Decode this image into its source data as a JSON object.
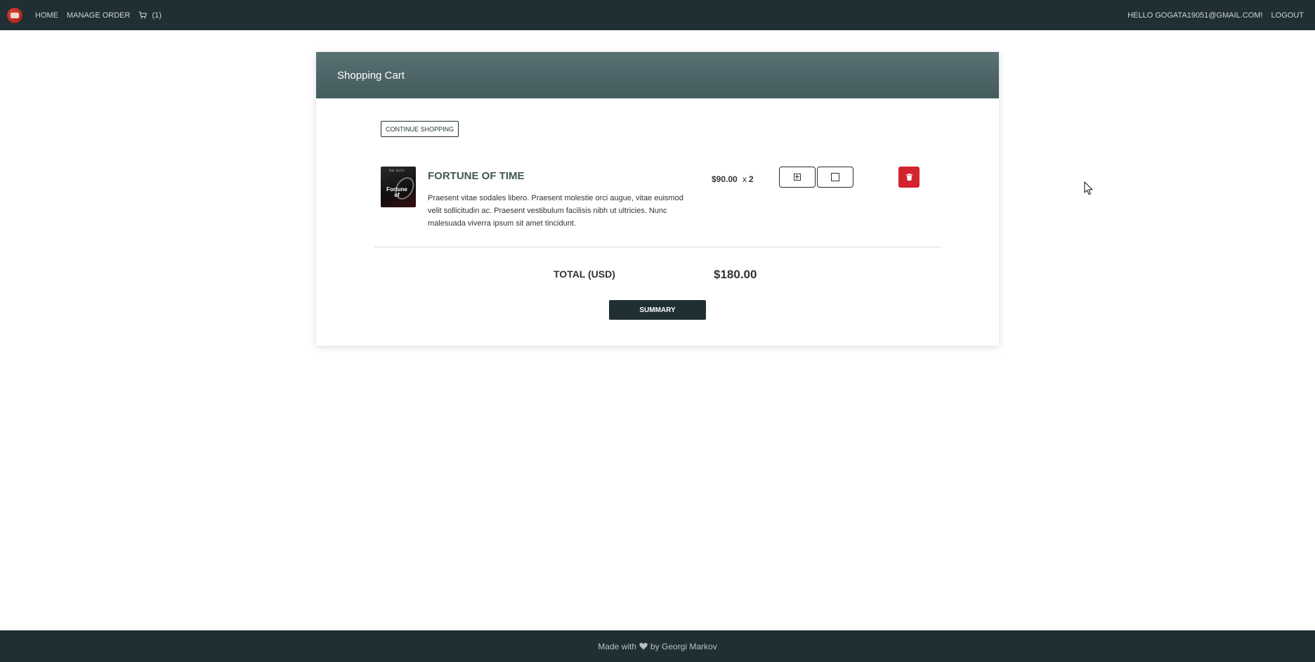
{
  "nav": {
    "home": "HOME",
    "manage_order": "MANAGE ORDER",
    "cart_count": "(1)",
    "greeting": "HELLO GOGATA19051@GMAIL.COM!",
    "logout": "LOGOUT"
  },
  "cart": {
    "title": "Shopping Cart",
    "continue_label": "CONTINUE SHOPPING",
    "items": [
      {
        "cover_author": "Rob Gaile",
        "cover_title": "Fortune of",
        "title": "FORTUNE OF TIME",
        "description": "Praesent vitae sodales libero. Praesent molestie orci augue, vitae euismod velit sollicitudin ac. Praesent vestibulum facilisis nibh ut ultricies. Nunc malesuada viverra ipsum sit amet tincidunt.",
        "price": "$90.00",
        "qty_x": "x",
        "qty": "2"
      }
    ],
    "total_label": "TOTAL (USD)",
    "total_value": "$180.00",
    "summary_label": "SUMMARY"
  },
  "footer": {
    "made_with": "Made with",
    "by": "by Georgi Markov"
  },
  "colors": {
    "navbar": "#1f2f33",
    "header": "#4f6669",
    "product_title": "#3e5a4a",
    "delete": "#d3232f"
  },
  "icons": [
    "logo-icon",
    "cart-icon",
    "plus-box-icon",
    "minus-box-icon",
    "trash-icon",
    "heart-icon",
    "mouse-cursor-icon"
  ]
}
